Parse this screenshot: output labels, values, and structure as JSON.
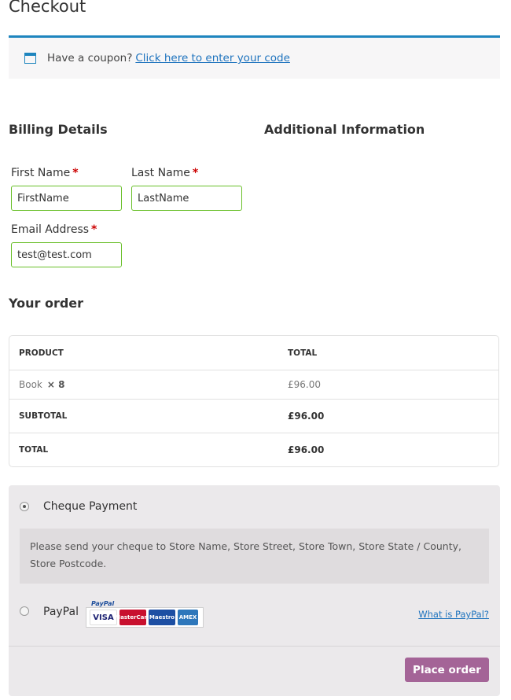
{
  "page": {
    "title": "Checkout"
  },
  "coupon": {
    "icon": "coupon-icon",
    "text": "Have a coupon?",
    "link": "Click here to enter your code"
  },
  "billing": {
    "heading": "Billing Details",
    "required_mark": "*",
    "first_name": {
      "label": "First Name",
      "value": "FirstName"
    },
    "last_name": {
      "label": "Last Name",
      "value": "LastName"
    },
    "email": {
      "label": "Email Address",
      "value": "test@test.com"
    }
  },
  "additional": {
    "heading": "Additional Information"
  },
  "order": {
    "heading": "Your order",
    "columns": [
      "PRODUCT",
      "TOTAL"
    ],
    "item": {
      "name": "Book",
      "qty": "× 8",
      "total": "£96.00"
    },
    "subtotal": {
      "label": "SUBTOTAL",
      "value": "£96.00"
    },
    "total": {
      "label": "TOTAL",
      "value": "£96.00"
    }
  },
  "payment": {
    "cheque": {
      "label": "Cheque Payment",
      "selected": true,
      "description": "Please send your cheque to Store Name, Store Street, Store Town, Store State / County, Store Postcode."
    },
    "paypal": {
      "label": "PayPal",
      "selected": false,
      "logo_text": "PayPal",
      "cards": [
        "VISA",
        "MasterCard",
        "Maestro",
        "AMEX"
      ],
      "what_link": "What is PayPal?"
    },
    "place_order": "Place order"
  },
  "colors": {
    "accent": "#1e85be",
    "field_border": "#69bf29",
    "required": "#cc0000",
    "button": "#a46497"
  }
}
